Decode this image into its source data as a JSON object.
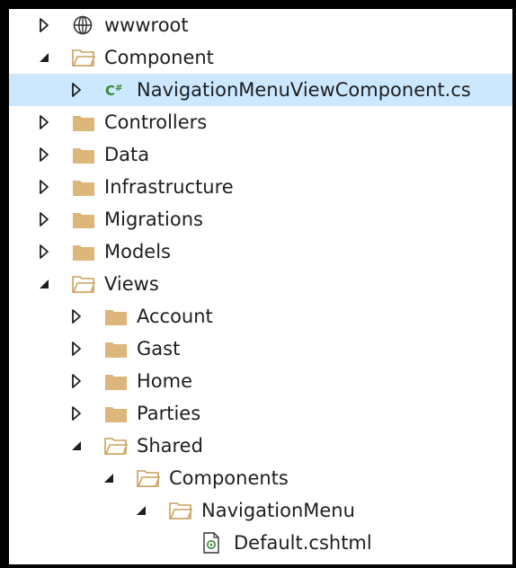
{
  "colors": {
    "folder": "#dcb67a",
    "folder_dark": "#c9a15d",
    "csharp": "#388a34",
    "selection": "#cce8ff",
    "arrow": "#1e1e1e"
  },
  "tree": [
    {
      "id": "wwwroot",
      "label": "wwwroot",
      "depth": 0,
      "state": "collapsed",
      "icon": "globe-icon"
    },
    {
      "id": "component",
      "label": "Component",
      "depth": 0,
      "state": "expanded",
      "icon": "folder-open-icon"
    },
    {
      "id": "navigation-menu-view-component-cs",
      "label": "NavigationMenuViewComponent.cs",
      "depth": 1,
      "state": "collapsed",
      "icon": "csharp-file-icon",
      "selected": true
    },
    {
      "id": "controllers",
      "label": "Controllers",
      "depth": 0,
      "state": "collapsed",
      "icon": "folder-icon"
    },
    {
      "id": "data",
      "label": "Data",
      "depth": 0,
      "state": "collapsed",
      "icon": "folder-icon"
    },
    {
      "id": "infrastructure",
      "label": "Infrastructure",
      "depth": 0,
      "state": "collapsed",
      "icon": "folder-icon"
    },
    {
      "id": "migrations",
      "label": "Migrations",
      "depth": 0,
      "state": "collapsed",
      "icon": "folder-icon"
    },
    {
      "id": "models",
      "label": "Models",
      "depth": 0,
      "state": "collapsed",
      "icon": "folder-icon"
    },
    {
      "id": "views",
      "label": "Views",
      "depth": 0,
      "state": "expanded",
      "icon": "folder-open-icon"
    },
    {
      "id": "account",
      "label": "Account",
      "depth": 1,
      "state": "collapsed",
      "icon": "folder-icon"
    },
    {
      "id": "gast",
      "label": "Gast",
      "depth": 1,
      "state": "collapsed",
      "icon": "folder-icon"
    },
    {
      "id": "home",
      "label": "Home",
      "depth": 1,
      "state": "collapsed",
      "icon": "folder-icon"
    },
    {
      "id": "parties",
      "label": "Parties",
      "depth": 1,
      "state": "collapsed",
      "icon": "folder-icon"
    },
    {
      "id": "shared",
      "label": "Shared",
      "depth": 1,
      "state": "expanded",
      "icon": "folder-open-icon"
    },
    {
      "id": "components",
      "label": "Components",
      "depth": 2,
      "state": "expanded",
      "icon": "folder-open-icon"
    },
    {
      "id": "navigationmenu",
      "label": "NavigationMenu",
      "depth": 3,
      "state": "expanded",
      "icon": "folder-open-icon"
    },
    {
      "id": "default-cshtml",
      "label": "Default.cshtml",
      "depth": 4,
      "state": "none",
      "icon": "razor-file-icon"
    }
  ]
}
